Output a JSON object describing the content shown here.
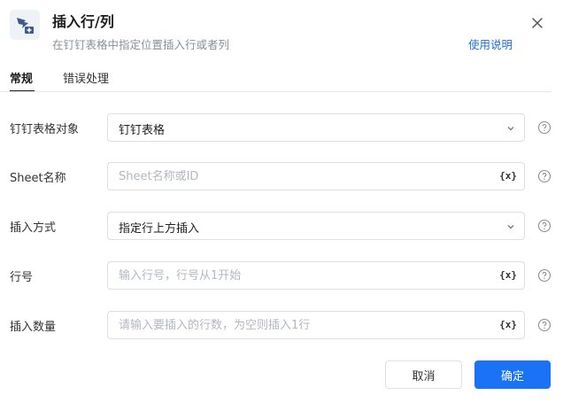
{
  "header": {
    "title": "插入行/列",
    "subtitle": "在钉钉表格中指定位置插入行或者列",
    "help_link": "使用说明",
    "app_icon": "dingtalk-sheet-icon",
    "close_icon": "close-icon"
  },
  "tabs": [
    {
      "label": "常规",
      "active": true
    },
    {
      "label": "错误处理",
      "active": false
    }
  ],
  "fields": [
    {
      "label": "钉钉表格对象",
      "type": "select",
      "value": "钉钉表格",
      "placeholder": ""
    },
    {
      "label": "Sheet名称",
      "type": "input",
      "value": "",
      "placeholder": "Sheet名称或ID",
      "var_label": "{x}"
    },
    {
      "label": "插入方式",
      "type": "select",
      "value": "指定行上方插入",
      "placeholder": ""
    },
    {
      "label": "行号",
      "type": "input",
      "value": "",
      "placeholder": "输入行号，行号从1开始",
      "var_label": "{x}"
    },
    {
      "label": "插入数量",
      "type": "input",
      "value": "",
      "placeholder": "请输入要插入的行数，为空则插入1行",
      "var_label": "{x}"
    }
  ],
  "footer": {
    "cancel": "取消",
    "confirm": "确定"
  },
  "colors": {
    "primary": "#1a73f5",
    "link": "#1e6fd9"
  }
}
